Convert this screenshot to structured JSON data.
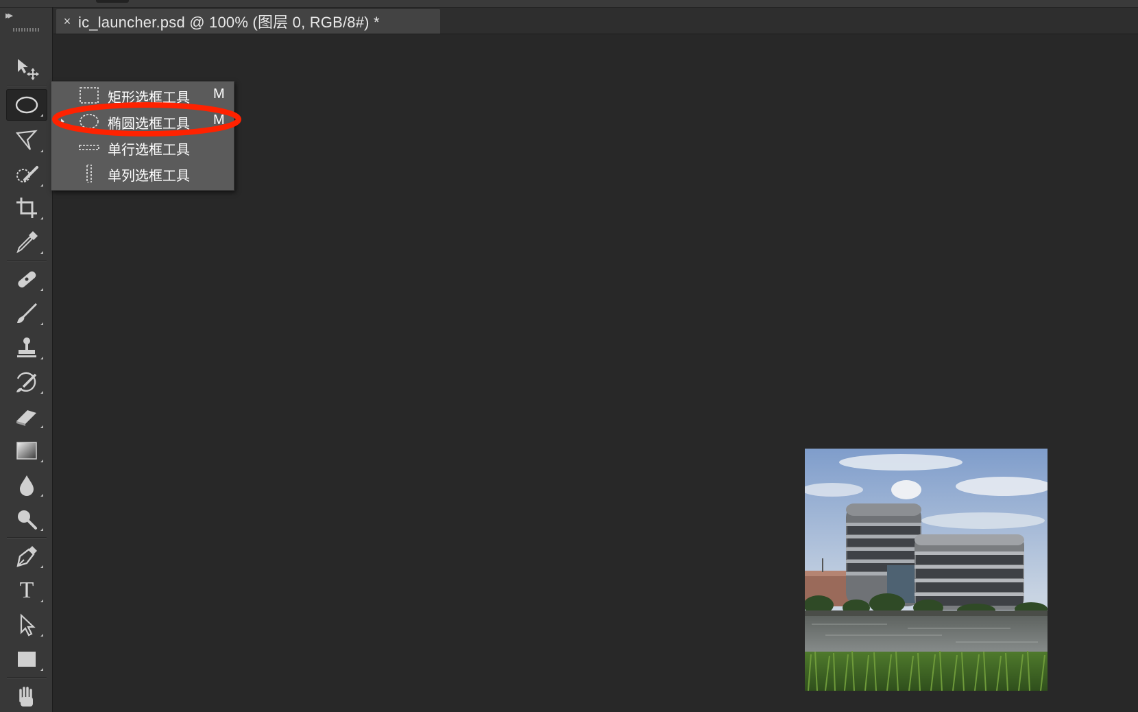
{
  "document": {
    "tab_close_symbol": "×",
    "tab_title": "ic_launcher.psd @ 100% (图层 0, RGB/8#) *"
  },
  "toolbar": {
    "collapse_symbol": "▸▸",
    "tools": [
      {
        "icon": "move-tool-icon"
      },
      {
        "icon": "elliptical-marquee-tool-icon",
        "active": true
      },
      {
        "icon": "polygonal-lasso-tool-icon"
      },
      {
        "icon": "quick-selection-tool-icon"
      },
      {
        "icon": "crop-tool-icon"
      },
      {
        "icon": "eyedropper-tool-icon"
      },
      {
        "icon": "healing-brush-tool-icon"
      },
      {
        "icon": "brush-tool-icon"
      },
      {
        "icon": "clone-stamp-tool-icon"
      },
      {
        "icon": "history-brush-tool-icon"
      },
      {
        "icon": "eraser-tool-icon"
      },
      {
        "icon": "gradient-tool-icon"
      },
      {
        "icon": "blur-tool-icon"
      },
      {
        "icon": "dodge-tool-icon"
      },
      {
        "icon": "pen-tool-icon"
      },
      {
        "icon": "type-tool-icon",
        "glyph": "T"
      },
      {
        "icon": "path-selection-tool-icon"
      },
      {
        "icon": "rectangle-tool-icon"
      },
      {
        "icon": "hand-tool-icon"
      }
    ]
  },
  "flyout": {
    "items": [
      {
        "label": "矩形选框工具",
        "shortcut": "M",
        "icon": "rectangular-marquee-icon"
      },
      {
        "label": "椭圆选框工具",
        "shortcut": "M",
        "icon": "elliptical-marquee-icon",
        "current": true
      },
      {
        "label": "单行选框工具",
        "shortcut": "",
        "icon": "single-row-marquee-icon"
      },
      {
        "label": "单列选框工具",
        "shortcut": "",
        "icon": "single-column-marquee-icon"
      }
    ]
  },
  "annotation": {
    "color": "#ff2200",
    "shape": "ellipse"
  },
  "canvas": {
    "background": "#282828",
    "image": "building-by-lake-photo"
  }
}
